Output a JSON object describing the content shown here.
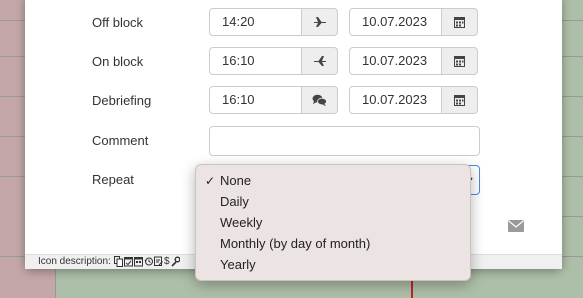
{
  "form": {
    "rows": [
      {
        "label": "Off block",
        "time": "14:20",
        "date": "10.07.2023",
        "time_icon": "airplane-takeoff-icon"
      },
      {
        "label": "On block",
        "time": "16:10",
        "date": "10.07.2023",
        "time_icon": "airplane-landing-icon"
      },
      {
        "label": "Debriefing",
        "time": "16:10",
        "date": "10.07.2023",
        "time_icon": "chat-bubbles-icon"
      }
    ],
    "comment_label": "Comment",
    "comment_value": "",
    "repeat_label": "Repeat",
    "repeat_selected": "None"
  },
  "dropdown": {
    "options": [
      "None",
      "Daily",
      "Weekly",
      "Monthly (by day of month)",
      "Yearly"
    ],
    "selected_index": 0,
    "checkmark": "✓"
  },
  "footer": {
    "description": "Icon description:",
    "dollar": "$"
  },
  "colors": {
    "accent_border": "#4a8ad9",
    "addon_bg": "#eeeeee",
    "dropdown_bg": "#ece4e2",
    "lane_green": "#aebfa9",
    "lane_pink": "#c4a7a9",
    "now_line": "#c0262c"
  }
}
